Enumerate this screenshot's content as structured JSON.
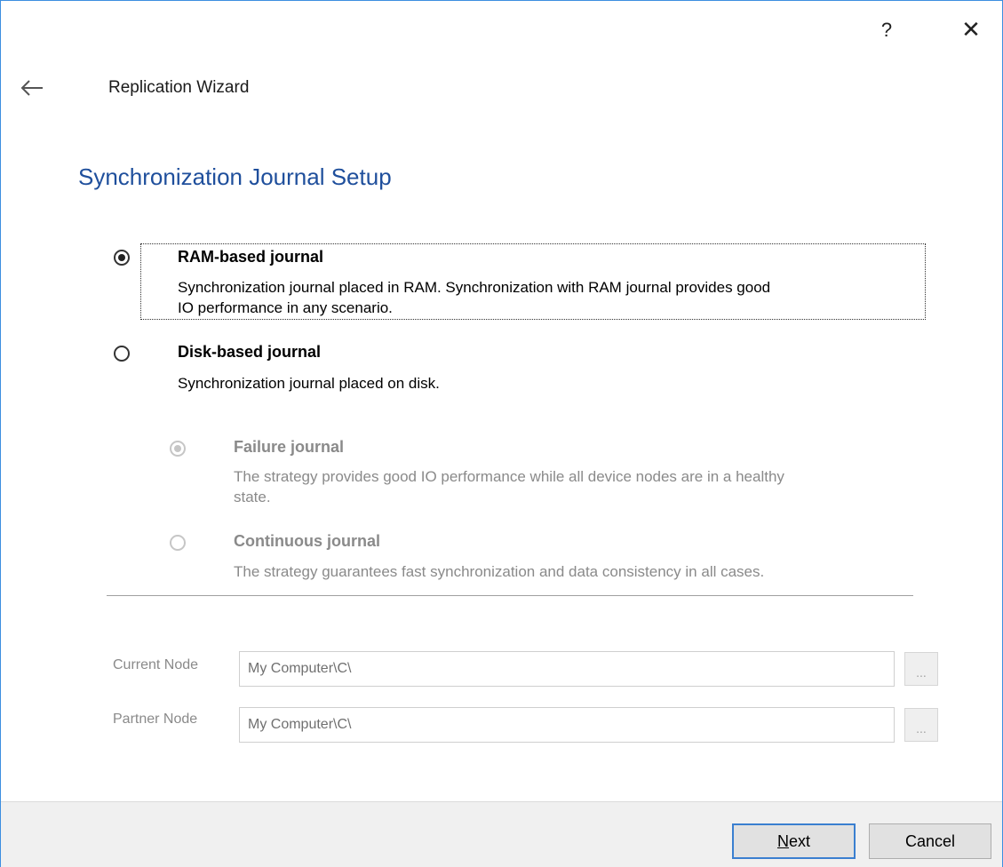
{
  "titlebar": {
    "help_label": "?",
    "close_label": "✕"
  },
  "header": {
    "app_title": "Replication Wizard",
    "page_title": "Synchronization Journal Setup"
  },
  "options": {
    "ram": {
      "title": "RAM-based journal",
      "desc_line1": "Synchronization journal placed in RAM. Synchronization with RAM journal provides good",
      "desc_line2": "IO performance in any scenario.",
      "selected": true
    },
    "disk": {
      "title": "Disk-based journal",
      "desc": "Synchronization journal placed on disk.",
      "selected": false
    },
    "failure": {
      "title": "Failure journal",
      "desc_line1": "The strategy provides good IO performance while all device nodes are in a healthy",
      "desc_line2": "state.",
      "selected": true,
      "enabled": false
    },
    "continuous": {
      "title": "Continuous journal",
      "desc": "The strategy guarantees fast synchronization and data consistency in all cases.",
      "selected": false,
      "enabled": false
    }
  },
  "fields": {
    "current_node": {
      "label": "Current Node",
      "value": "My Computer\\C\\"
    },
    "partner_node": {
      "label": "Partner Node",
      "value": "My Computer\\C\\"
    },
    "browse_label": "..."
  },
  "footer": {
    "next_label_underlined": "N",
    "next_label_rest": "ext",
    "cancel_label": "Cancel"
  },
  "colors": {
    "title_blue": "#1f4f9c",
    "disabled_gray": "#8a8a8a",
    "focus_blue": "#3a7fd0"
  }
}
